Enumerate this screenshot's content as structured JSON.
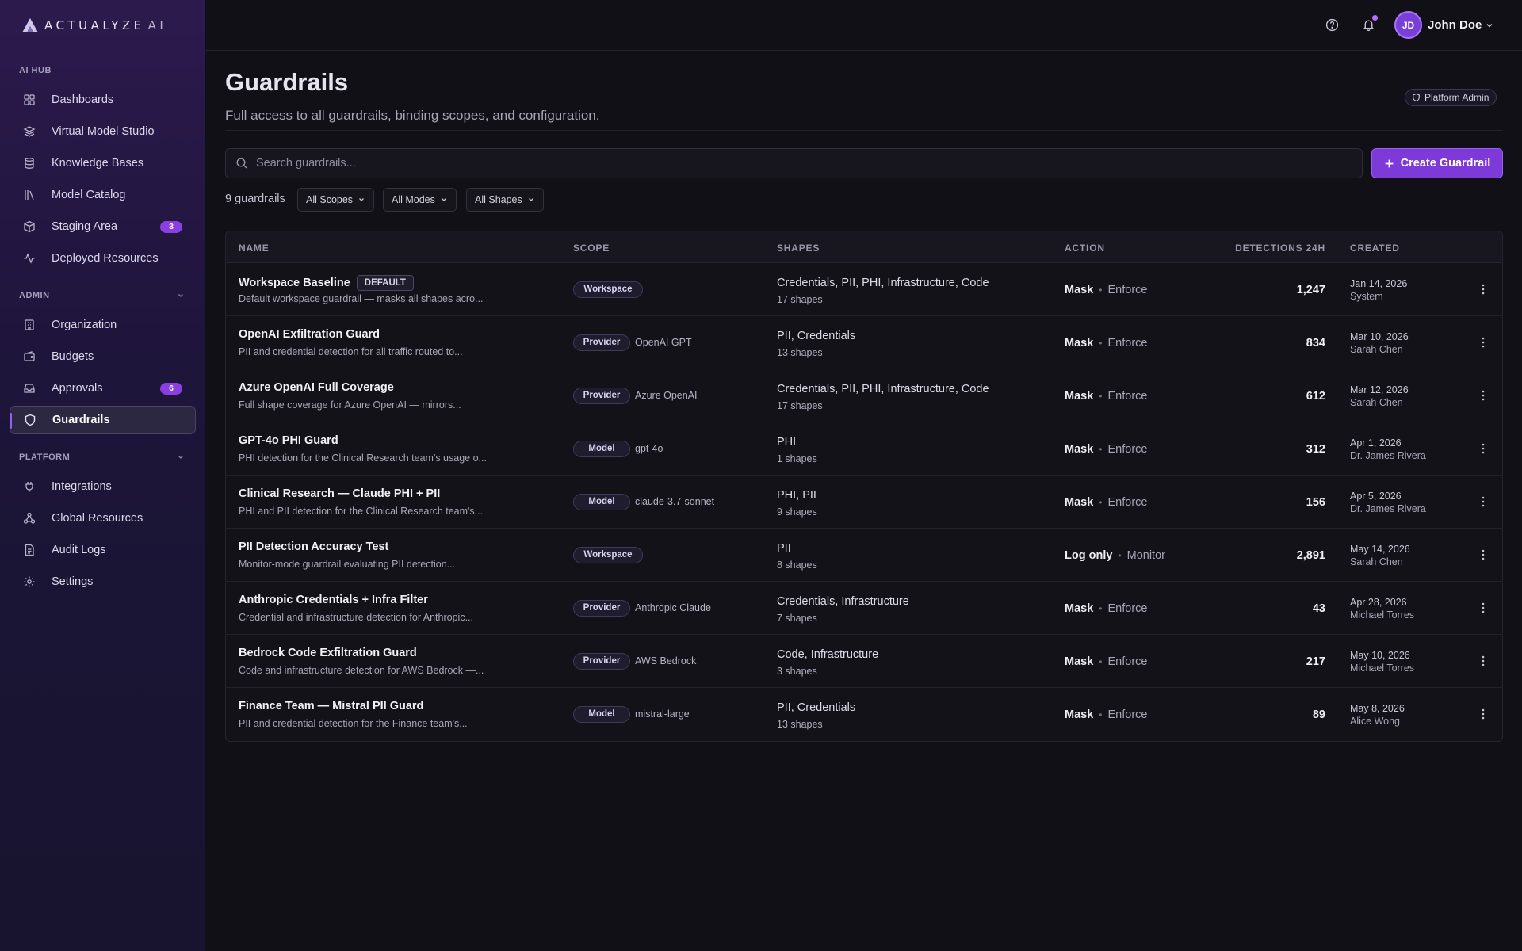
{
  "brand": {
    "name": "ACTUALYZE",
    "suffix": "AI"
  },
  "sidebar": {
    "sections": [
      {
        "label": "AI HUB",
        "collapsible": false
      },
      {
        "label": "ADMIN",
        "collapsible": true
      },
      {
        "label": "PLATFORM",
        "collapsible": true
      }
    ],
    "items": [
      {
        "label": "Dashboards",
        "icon": "grid-icon",
        "badge": ""
      },
      {
        "label": "Virtual Model Studio",
        "icon": "layers-icon",
        "badge": ""
      },
      {
        "label": "Knowledge Bases",
        "icon": "database-icon",
        "badge": ""
      },
      {
        "label": "Model Catalog",
        "icon": "library-icon",
        "badge": ""
      },
      {
        "label": "Staging Area",
        "icon": "box-icon",
        "badge": "3"
      },
      {
        "label": "Deployed Resources",
        "icon": "activity-icon",
        "badge": ""
      },
      {
        "label": "Organization",
        "icon": "building-icon",
        "badge": ""
      },
      {
        "label": "Budgets",
        "icon": "wallet-icon",
        "badge": ""
      },
      {
        "label": "Approvals",
        "icon": "inbox-icon",
        "badge": "6"
      },
      {
        "label": "Guardrails",
        "icon": "shield-icon",
        "badge": "",
        "active": true
      },
      {
        "label": "Integrations",
        "icon": "plug-icon",
        "badge": ""
      },
      {
        "label": "Global Resources",
        "icon": "network-icon",
        "badge": ""
      },
      {
        "label": "Audit Logs",
        "icon": "file-icon",
        "badge": ""
      },
      {
        "label": "Settings",
        "icon": "gear-icon",
        "badge": ""
      }
    ]
  },
  "header": {
    "user_initials": "JD",
    "user_name": "John Doe",
    "has_notification": true
  },
  "page": {
    "title": "Guardrails",
    "subtitle": "Full access to all guardrails, binding scopes, and configuration.",
    "role_badge": "Platform Admin"
  },
  "search": {
    "placeholder": "Search guardrails...",
    "value": ""
  },
  "create_button": "Create Guardrail",
  "count_label": "9 guardrails",
  "filters": [
    "All Scopes",
    "All Modes",
    "All Shapes"
  ],
  "columns": [
    "NAME",
    "SCOPE",
    "SHAPES",
    "ACTION",
    "DETECTIONS 24H",
    "CREATED"
  ],
  "rows": [
    {
      "name": "Workspace Baseline",
      "tag": "DEFAULT",
      "desc": "Default workspace guardrail — masks all shapes acro...",
      "scope": "Workspace",
      "target": "",
      "shapes": "Credentials, PII, PHI, Infrastructure, Code",
      "shape_count": "17 shapes",
      "action": "Mask",
      "mode": "Enforce",
      "detections": "1,247",
      "date": "Jan 14, 2026",
      "by": "System"
    },
    {
      "name": "OpenAI Exfiltration Guard",
      "tag": "",
      "desc": "PII and credential detection for all traffic routed to...",
      "scope": "Provider",
      "target": "OpenAI GPT",
      "shapes": "PII, Credentials",
      "shape_count": "13 shapes",
      "action": "Mask",
      "mode": "Enforce",
      "detections": "834",
      "date": "Mar 10, 2026",
      "by": "Sarah Chen"
    },
    {
      "name": "Azure OpenAI Full Coverage",
      "tag": "",
      "desc": "Full shape coverage for Azure OpenAI — mirrors...",
      "scope": "Provider",
      "target": "Azure OpenAI",
      "shapes": "Credentials, PII, PHI, Infrastructure, Code",
      "shape_count": "17 shapes",
      "action": "Mask",
      "mode": "Enforce",
      "detections": "612",
      "date": "Mar 12, 2026",
      "by": "Sarah Chen"
    },
    {
      "name": "GPT-4o PHI Guard",
      "tag": "",
      "desc": "PHI detection for the Clinical Research team's usage o...",
      "scope": "Model",
      "target": "gpt-4o",
      "shapes": "PHI",
      "shape_count": "1 shapes",
      "action": "Mask",
      "mode": "Enforce",
      "detections": "312",
      "date": "Apr 1, 2026",
      "by": "Dr. James Rivera"
    },
    {
      "name": "Clinical Research — Claude PHI + PII",
      "tag": "",
      "desc": "PHI and PII detection for the Clinical Research team's...",
      "scope": "Model",
      "target": "claude-3.7-sonnet",
      "shapes": "PHI, PII",
      "shape_count": "9 shapes",
      "action": "Mask",
      "mode": "Enforce",
      "detections": "156",
      "date": "Apr 5, 2026",
      "by": "Dr. James Rivera"
    },
    {
      "name": "PII Detection Accuracy Test",
      "tag": "",
      "desc": "Monitor-mode guardrail evaluating PII detection...",
      "scope": "Workspace",
      "target": "",
      "shapes": "PII",
      "shape_count": "8 shapes",
      "action": "Log only",
      "mode": "Monitor",
      "detections": "2,891",
      "date": "May 14, 2026",
      "by": "Sarah Chen"
    },
    {
      "name": "Anthropic Credentials + Infra Filter",
      "tag": "",
      "desc": "Credential and infrastructure detection for Anthropic...",
      "scope": "Provider",
      "target": "Anthropic Claude",
      "shapes": "Credentials, Infrastructure",
      "shape_count": "7 shapes",
      "action": "Mask",
      "mode": "Enforce",
      "detections": "43",
      "date": "Apr 28, 2026",
      "by": "Michael Torres"
    },
    {
      "name": "Bedrock Code Exfiltration Guard",
      "tag": "",
      "desc": "Code and infrastructure detection for AWS Bedrock —...",
      "scope": "Provider",
      "target": "AWS Bedrock",
      "shapes": "Code, Infrastructure",
      "shape_count": "3 shapes",
      "action": "Mask",
      "mode": "Enforce",
      "detections": "217",
      "date": "May 10, 2026",
      "by": "Michael Torres"
    },
    {
      "name": "Finance Team — Mistral PII Guard",
      "tag": "",
      "desc": "PII and credential detection for the Finance team's...",
      "scope": "Model",
      "target": "mistral-large",
      "shapes": "PII, Credentials",
      "shape_count": "13 shapes",
      "action": "Mask",
      "mode": "Enforce",
      "detections": "89",
      "date": "May 8, 2026",
      "by": "Alice Wong"
    }
  ],
  "colors": {
    "accent": "#7d3ad9",
    "badge": "#8b3fe0",
    "background": "#111017"
  }
}
